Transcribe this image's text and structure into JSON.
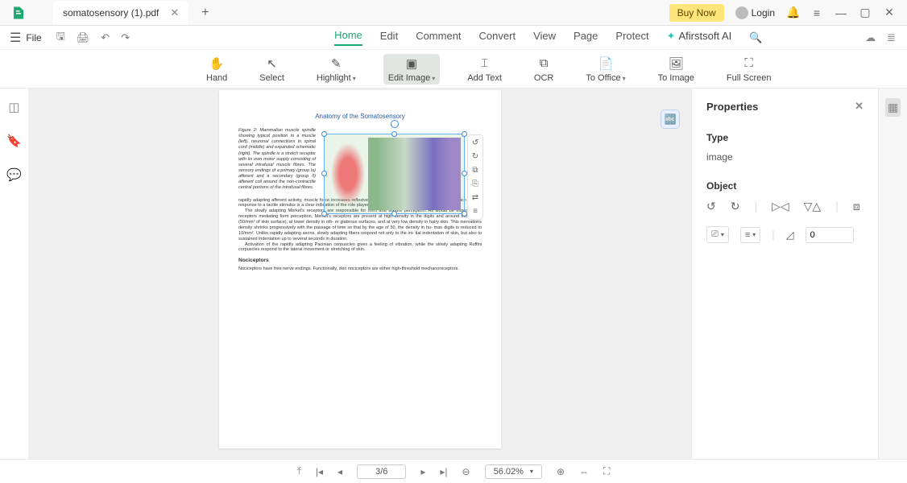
{
  "titlebar": {
    "tab_name": "somatosensory (1).pdf",
    "buy_now": "Buy Now",
    "login": "Login"
  },
  "menubar": {
    "file": "File",
    "tabs": [
      "Home",
      "Edit",
      "Comment",
      "Convert",
      "View",
      "Page",
      "Protect"
    ],
    "ai_label": "Afirstsoft AI"
  },
  "ribbon": {
    "hand": "Hand",
    "select": "Select",
    "highlight": "Highlight",
    "edit_image": "Edit Image",
    "add_text": "Add Text",
    "ocr": "OCR",
    "to_office": "To Office",
    "to_image": "To Image",
    "full_screen": "Full Screen"
  },
  "document": {
    "title": "Anatomy of the Somatosensory",
    "fig_caption": "Figure 2: Mammalian muscle spindle showing typical position in a muscle (left), neuronal connections in spinal cord (middle) and expanded schematic (right). The spindle is a stretch receptor with its own motor supply consisting of several intrafusal muscle fibres. The sensory endings of a primary (group Ia) afferent and a secondary (group II) afferent coil around the non-contractile central portions of the intrafusal fibres.",
    "para1": "rapidly adapting afferent activity, muscle force increases reflexively until the gripped object no longer moves. Such a rapid response to a tactile stimulus is a clear indication of the role played by somatosensory neurons in motor ac- tivity.",
    "para2": "The slowly adapting Merkel's receptors are responsible for form and texture perception. As would be expected for receptors mediating form perception, Merkel's receptors are present at high density in the digits and around the mouth (50/mm² of skin surface), at lower density in oth- er glabrous surfaces, and at very low density in hairy skin. This inervations density shrinks progressively with the passage of time so that by the age of 50, the density in hu- man digits is reduced to 10/mm². Unlike rapidly adapting axons, slowly adapting fibers respond not only to the ini- tial indentation of skin, but also to sustained indentation up to several seconds in duration.",
    "para3": "Activation of the rapidly adapting Pacinian corpuscles gives a feeling of vibration, while the slowly adapting Ruffini corpuscles respond to the lateral movement or stretching of skin.",
    "h_noci": "Nociceptors",
    "para4": "Nociceptors have free nerve endings. Functionally, skin nociceptors are either high-threshold mechanoreceptors."
  },
  "properties": {
    "header": "Properties",
    "type_label": "Type",
    "type_value": "image",
    "object_label": "Object",
    "angle_value": "0"
  },
  "bottombar": {
    "page": "3/6",
    "zoom": "56.02%"
  }
}
